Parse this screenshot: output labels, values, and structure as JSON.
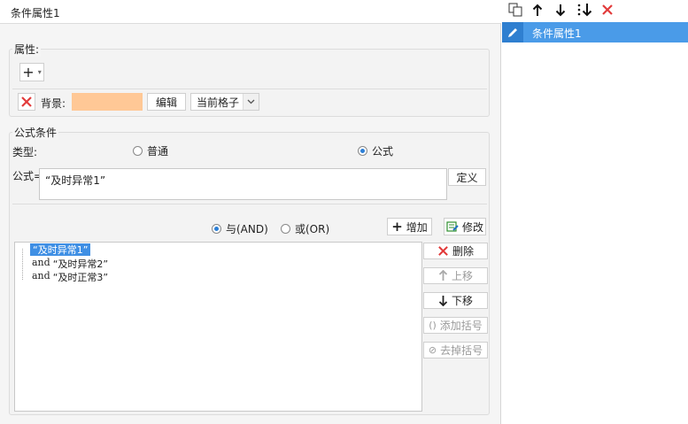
{
  "window": {
    "title": "条件属性1"
  },
  "attributes": {
    "label": "属性:",
    "add_button": "+",
    "background_label": "背景:",
    "background_color": "#FFC896",
    "edit_button": "编辑",
    "scope_value": "当前格子"
  },
  "formula": {
    "group_label": "公式条件",
    "type_label": "类型:",
    "type_normal": "普通",
    "type_formula": "公式",
    "formula_label": "公式=",
    "formula_value": "“及时异常1”",
    "define_button": "定义",
    "and_label": "与(AND)",
    "or_label": "或(OR)",
    "add_button": "增加",
    "modify_button": "修改"
  },
  "conditions": [
    {
      "text": "“及时异常1”",
      "prefix": ""
    },
    {
      "text": "“及时异常2”",
      "prefix": "and"
    },
    {
      "text": "“及时正常3”",
      "prefix": "and"
    }
  ],
  "side_buttons": {
    "delete": "删除",
    "up": "上移",
    "down": "下移",
    "add_paren": "添加括号",
    "remove_paren": "去掉括号"
  },
  "right_panel": {
    "items": [
      {
        "label": "条件属性1"
      }
    ]
  },
  "colors": {
    "accent": "#4a9be8",
    "delete_red": "#e23b3b",
    "bg_swatch": "#FFC896"
  }
}
